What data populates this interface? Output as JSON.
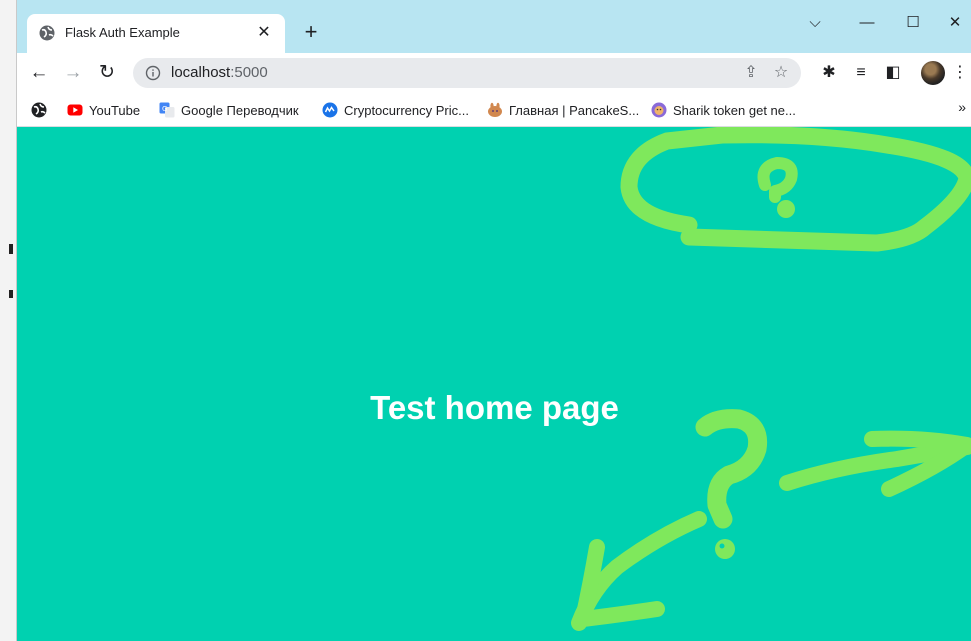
{
  "tab": {
    "title": "Flask Auth Example",
    "close_glyph": "✕"
  },
  "new_tab_glyph": "+",
  "window_controls": {
    "dropdown": "⌵",
    "minimize": "—",
    "maximize": "☐",
    "close": "✕"
  },
  "toolbar": {
    "back": "←",
    "forward": "→",
    "reload": "↻",
    "url_host": "localhost",
    "url_port": ":5000",
    "share": "⇪",
    "star": "☆",
    "extensions": "✱",
    "media": "≡",
    "sidepanel": "◧",
    "menu": "⋮"
  },
  "bookmarks": {
    "items": [
      {
        "label": "YouTube",
        "icon": "youtube-icon",
        "color": "#ff0000"
      },
      {
        "label": "Google Переводчик",
        "icon": "google-translate-icon",
        "color": "#4285f4"
      },
      {
        "label": "Cryptocurrency Pric...",
        "icon": "coinmarketcap-icon",
        "color": "#1a73e8"
      },
      {
        "label": "Главная | PancakeS...",
        "icon": "pancakeswap-icon",
        "color": "#d1884f"
      },
      {
        "label": "Sharik token get ne...",
        "icon": "sharik-token-icon",
        "color": "#8a6ad8"
      }
    ],
    "overflow": "»"
  },
  "page": {
    "heading": "Test home page",
    "background": "#00d1b0",
    "annotation_color": "#7fe85c"
  }
}
